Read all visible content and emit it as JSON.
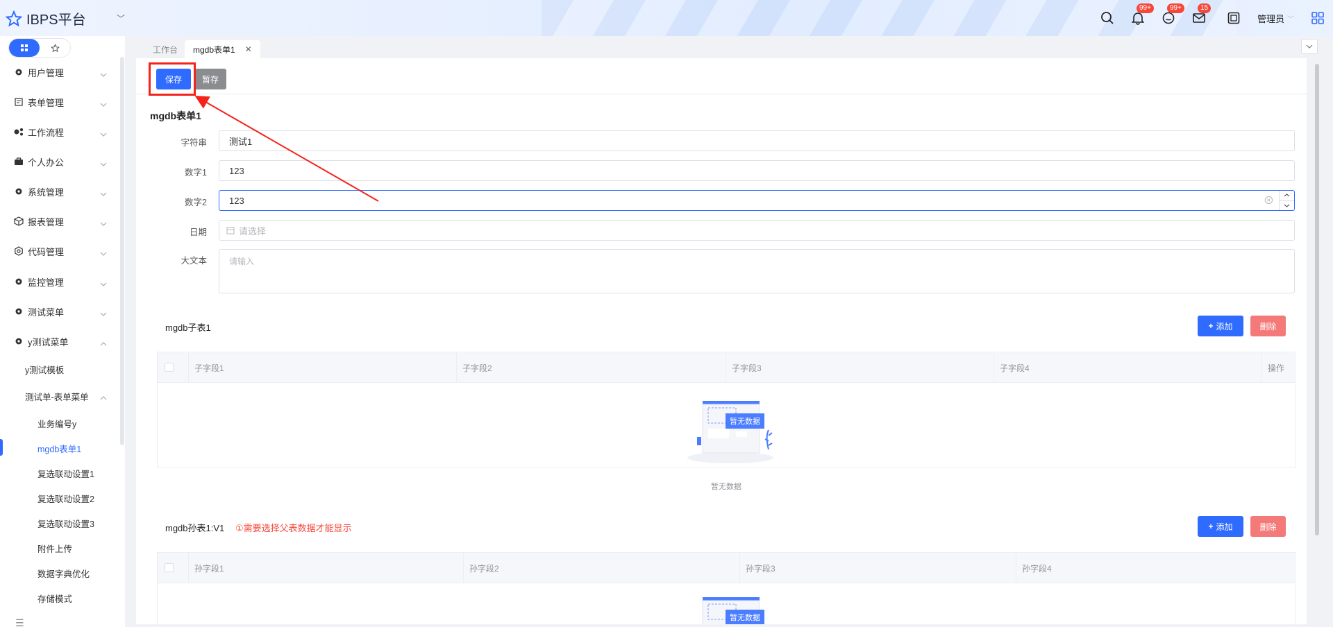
{
  "header": {
    "app_title": "IBPS平台",
    "badges": {
      "notifications": "99+",
      "messages": "99+",
      "mail": "15"
    },
    "user": "管理员"
  },
  "sidebar": {
    "items": [
      {
        "label": "用户管理",
        "icon": "gear-icon"
      },
      {
        "label": "表单管理",
        "icon": "form-icon"
      },
      {
        "label": "工作流程",
        "icon": "workflow-icon"
      },
      {
        "label": "个人办公",
        "icon": "briefcase-icon"
      },
      {
        "label": "系统管理",
        "icon": "gear-icon"
      },
      {
        "label": "报表管理",
        "icon": "cube-icon"
      },
      {
        "label": "代码管理",
        "icon": "code-icon"
      },
      {
        "label": "监控管理",
        "icon": "gear-icon"
      },
      {
        "label": "测试菜单",
        "icon": "gear-icon"
      },
      {
        "label": "y测试菜单",
        "icon": "gear-icon"
      }
    ],
    "sub1": "y测试模板",
    "sub2": "测试单-表单菜单",
    "sub3": [
      "业务编号y",
      "mgdb表单1",
      "复选联动设置1",
      "复选联动设置2",
      "复选联动设置3",
      "附件上传",
      "数据字典优化",
      "存储模式"
    ],
    "active": "mgdb表单1"
  },
  "tabs": [
    {
      "label": "工作台"
    },
    {
      "label": "mgdb表单1"
    }
  ],
  "toolbar": {
    "save": "保存",
    "draft": "暂存"
  },
  "form": {
    "title": "mgdb表单1",
    "fields": [
      {
        "label": "字符串",
        "value": "测试1"
      },
      {
        "label": "数字1",
        "value": "123"
      },
      {
        "label": "数字2",
        "value": "123"
      },
      {
        "label": "日期",
        "placeholder": "请选择"
      },
      {
        "label": "大文本",
        "placeholder": "请输入"
      }
    ]
  },
  "sub_table1": {
    "title": "mgdb子表1",
    "add": "添加",
    "delete": "删除",
    "columns": [
      "子字段1",
      "子字段2",
      "子字段3",
      "子字段4",
      "操作"
    ],
    "empty_badge": "暂无数据",
    "empty_text": "暂无数据"
  },
  "sub_table2": {
    "title": "mgdb孙表1:V1",
    "warning": "①需要选择父表数据才能显示",
    "add": "添加",
    "delete": "删除",
    "columns": [
      "孙字段1",
      "孙字段2",
      "孙字段3",
      "孙字段4"
    ],
    "empty_badge": "暂无数据"
  },
  "colors": {
    "primary": "#2f6bff",
    "danger": "#f47a7a",
    "annotation": "#f5221b"
  }
}
